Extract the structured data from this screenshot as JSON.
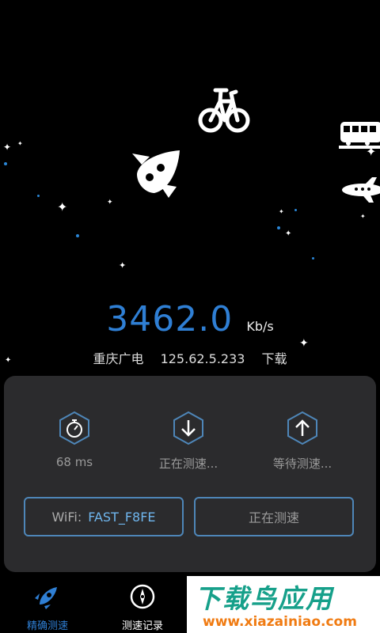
{
  "speed": {
    "value": "3462.0",
    "unit": "Kb/s"
  },
  "server": {
    "isp": "重庆广电",
    "ip": "125.62.5.233",
    "direction": "下载"
  },
  "stats": [
    {
      "icon": "stopwatch-icon",
      "label": "68 ms"
    },
    {
      "icon": "download-arrow-icon",
      "label": "正在测速..."
    },
    {
      "icon": "upload-arrow-icon",
      "label": "等待测速..."
    }
  ],
  "wifi": {
    "prefix": "WiFi:",
    "ssid": "FAST_F8FE"
  },
  "action_button": {
    "label": "正在测速"
  },
  "nav": [
    {
      "label": "精确测速",
      "icon": "rocket-icon",
      "active": true,
      "color": "#2f7fd4"
    },
    {
      "label": "测速记录",
      "icon": "compass-icon",
      "active": false,
      "color": "#ffffff"
    }
  ],
  "watermark": {
    "title": "下载鸟应用",
    "url": "www.xiazainiao.com"
  },
  "colors": {
    "accent": "#2f7fd4",
    "panel": "#2b2b2d",
    "border": "#4e86b8"
  }
}
